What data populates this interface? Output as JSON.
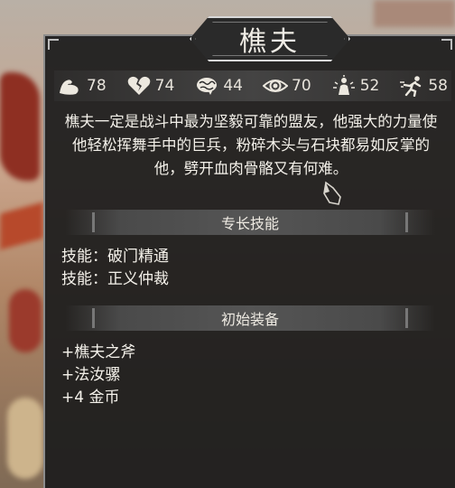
{
  "character": {
    "name": "樵夫",
    "description": "樵夫一定是战斗中最为坚毅可靠的盟友，他强大的力量使他轻松挥舞手中的巨兵，粉碎木头与石块都易如反掌的他，劈开血肉骨骼又有何难。"
  },
  "stats": [
    {
      "icon": "strength-arm-icon",
      "value": "78"
    },
    {
      "icon": "broken-heart-icon",
      "value": "74"
    },
    {
      "icon": "brain-icon",
      "value": "44"
    },
    {
      "icon": "eye-icon",
      "value": "70"
    },
    {
      "icon": "spirit-figure-icon",
      "value": "52"
    },
    {
      "icon": "running-figure-icon",
      "value": "58"
    }
  ],
  "sections": {
    "skills_title": "专长技能",
    "skills": [
      "技能：破门精通",
      "技能：正义仲裁"
    ],
    "equipment_title": "初始装备",
    "equipment": [
      "+樵夫之斧",
      "+法汝骡",
      "+4 金币"
    ]
  },
  "colors": {
    "panel": "#1e1e1e",
    "text": "#f4f1ea",
    "border": "#8c8c8c"
  }
}
